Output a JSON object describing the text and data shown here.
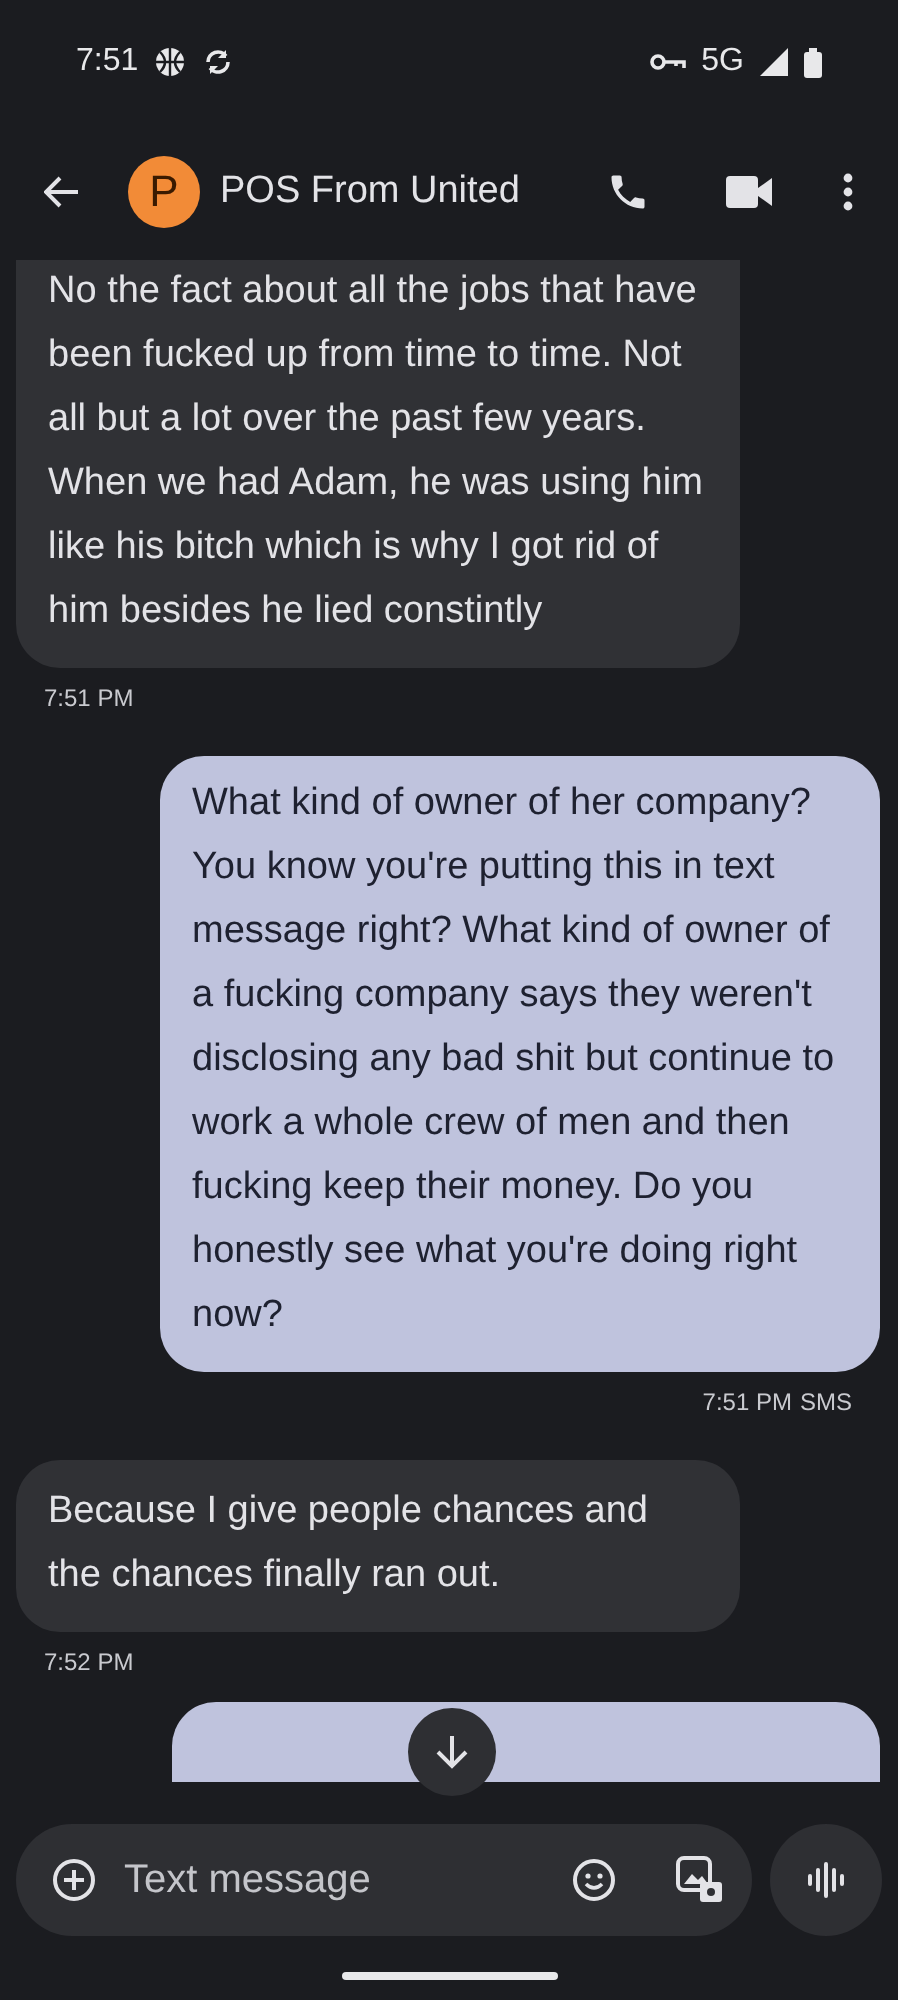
{
  "status_bar": {
    "time": "7:51",
    "network": "5G"
  },
  "header": {
    "avatar_letter": "P",
    "contact": "POS From United"
  },
  "messages": [
    {
      "kind": "incoming",
      "text": "No the fact about all the jobs that have been fucked up from time to time. Not all but a lot over the past few years. When we had Adam, he was using him like his bitch which is why I got rid of him besides he lied constintly",
      "timestamp": "7:51 PM"
    },
    {
      "kind": "outgoing",
      "text": "What kind of owner of her company? You know you're putting this in text message right? What kind of owner of a fucking company says they weren't disclosing any bad shit but continue to work a whole crew of men and then fucking keep their money. Do you honestly see what you're doing right now?",
      "timestamp": "7:51 PM",
      "transport": "SMS"
    },
    {
      "kind": "incoming",
      "text": "Because I give people chances and the chances finally ran out.",
      "timestamp": "7:52 PM"
    }
  ],
  "composer": {
    "placeholder": "Text message"
  }
}
